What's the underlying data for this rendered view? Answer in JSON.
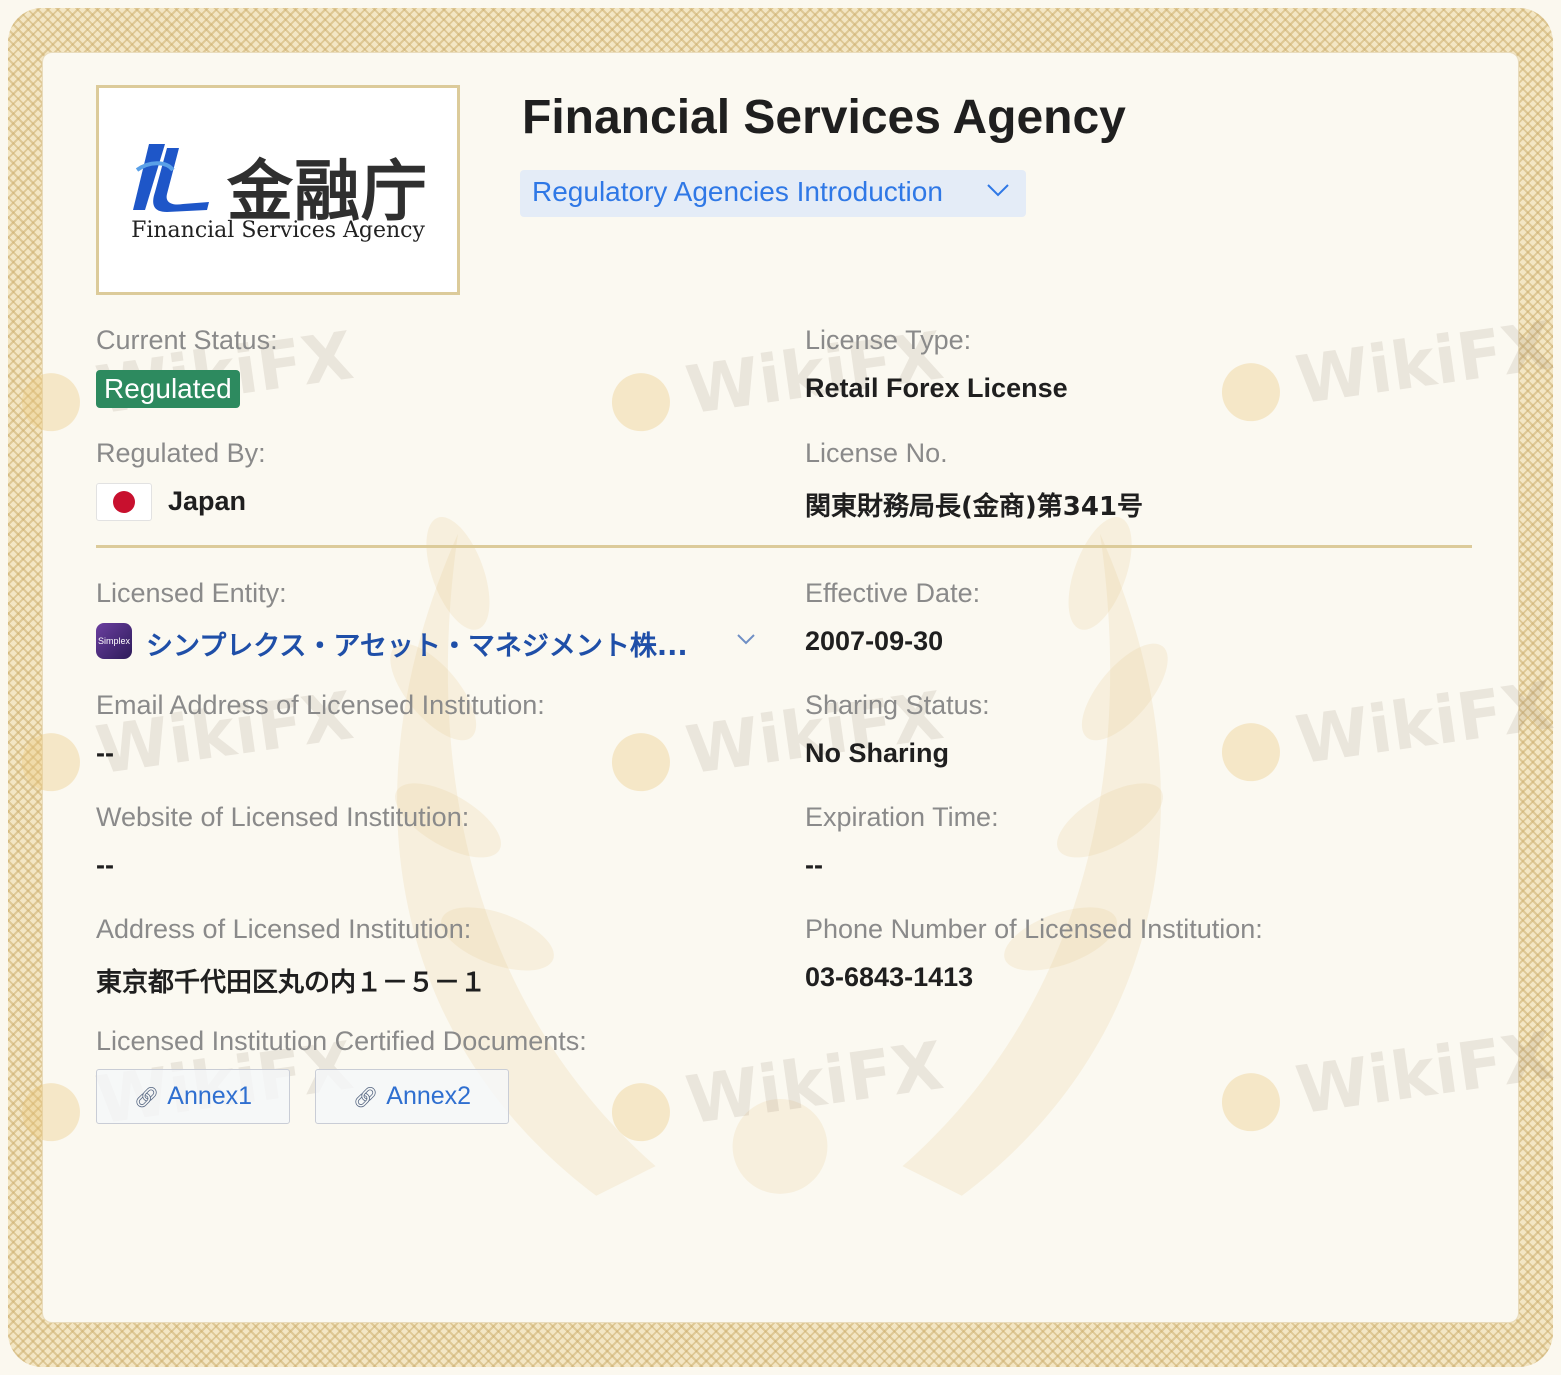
{
  "logo": {
    "kanji": "金融庁",
    "english": "Financial Services Agency"
  },
  "agency": {
    "title": "Financial Services Agency",
    "intro_link": "Regulatory Agencies Introduction"
  },
  "watermark_text": "WikiFX",
  "fields": {
    "current_status": {
      "label": "Current Status:",
      "value": "Regulated",
      "color": "#2d8a5f"
    },
    "license_type": {
      "label": "License Type:",
      "value": "Retail Forex License"
    },
    "regulated_by": {
      "label": "Regulated By:",
      "value": "Japan",
      "flag_icon": "japan-flag"
    },
    "license_no": {
      "label": "License No.",
      "value": "関東財務局長(金商)第341号"
    },
    "licensed_entity": {
      "label": "Licensed Entity:",
      "value": "シンプレクス・アセット・マネジメント株...",
      "icon_text": "Simplex"
    },
    "effective_date": {
      "label": "Effective Date:",
      "value": "2007-09-30"
    },
    "email": {
      "label": "Email Address of Licensed Institution:",
      "value": "--"
    },
    "sharing_status": {
      "label": "Sharing Status:",
      "value": "No Sharing"
    },
    "website": {
      "label": "Website of Licensed Institution:",
      "value": "--"
    },
    "expiration_time": {
      "label": "Expiration Time:",
      "value": "--"
    },
    "address": {
      "label": "Address of Licensed Institution:",
      "value": "東京都千代田区丸の内１－５－１"
    },
    "phone": {
      "label": "Phone Number of Licensed Institution:",
      "value": "03-6843-1413"
    },
    "documents": {
      "label": "Licensed Institution Certified Documents:",
      "items": [
        "Annex1",
        "Annex2"
      ]
    }
  },
  "colors": {
    "accent_link": "#2f78e6",
    "regulated_badge": "#2d8a5f",
    "border_gold": "#dccb9a"
  }
}
